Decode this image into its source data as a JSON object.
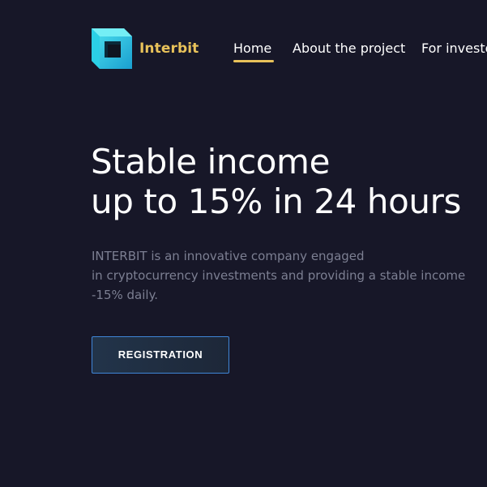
{
  "header": {
    "brand": "Interbit",
    "logo_icon": "cube-logo-icon",
    "nav": {
      "home": "Home",
      "about": "About the project",
      "investors": "For investors"
    },
    "active_tab": "Home"
  },
  "hero": {
    "title_line1": "Stable income",
    "title_line2": "up to 15% in 24 hours",
    "description_line1": "INTERBIT is an innovative company engaged",
    "description_line2": "in cryptocurrency investments and providing a stable income",
    "description_line3": "-15% daily.",
    "cta_label": "REGISTRATION"
  },
  "colors": {
    "background": "#171728",
    "accent_gold": "#e8c25a",
    "accent_cyan": "#1ec8e0",
    "button_border": "#3f86d8",
    "muted_text": "#7c7f92"
  }
}
